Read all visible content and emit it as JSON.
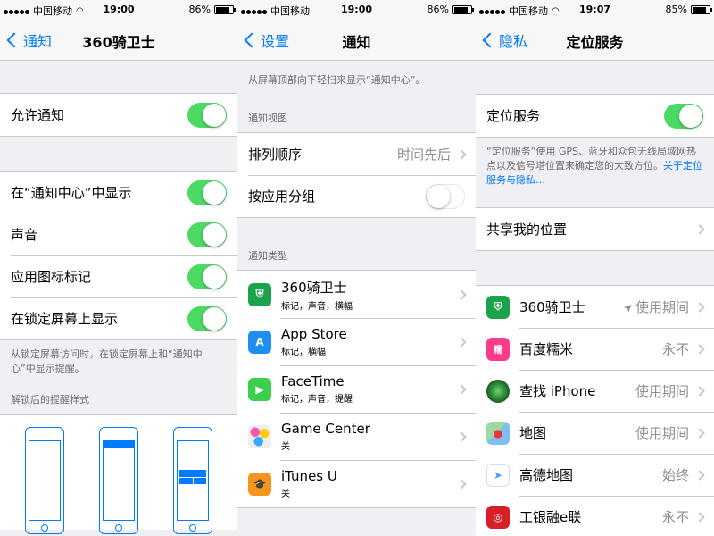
{
  "statusbars": [
    {
      "carrier": "中国移动",
      "time": "19:00",
      "battery": "86%",
      "battery_fill": 0.86
    },
    {
      "carrier": "中国移动",
      "time": "19:00",
      "battery": "86%",
      "battery_fill": 0.86
    },
    {
      "carrier": "中国移动",
      "time": "19:07",
      "battery": "85%",
      "battery_fill": 0.85
    }
  ],
  "screen1": {
    "back_label": "通知",
    "title": "360骑卫士",
    "allow_label": "允许通知",
    "rows": [
      {
        "label": "在“通知中心”中显示"
      },
      {
        "label": "声音"
      },
      {
        "label": "应用图标标记"
      },
      {
        "label": "在锁定屏幕上显示"
      }
    ],
    "footer": "从锁定屏幕访问时，在锁定屏幕上和“通知中心”中显示提醒。",
    "alert_style_header": "解锁后的提醒样式"
  },
  "screen2": {
    "back_label": "设置",
    "title": "通知",
    "intro": "从屏幕顶部向下轻扫来显示“通知中心”。",
    "view_header": "通知视图",
    "sort_label": "排列顺序",
    "sort_value": "时间先后",
    "group_label": "按应用分组",
    "type_header": "通知类型",
    "apps": [
      {
        "name": "360骑卫士",
        "sub": "标记，声音，横幅",
        "icon": "shield-icon",
        "color": "#1aa34a"
      },
      {
        "name": "App Store",
        "sub": "标记，横幅",
        "icon": "app-store-icon",
        "color": "#1e8ef0"
      },
      {
        "name": "FaceTime",
        "sub": "标记，声音，提醒",
        "icon": "video-camera-icon",
        "color": "#3ccf4e"
      },
      {
        "name": "Game Center",
        "sub": "关",
        "icon": "game-center-icon",
        "color": "#e8e8e8"
      },
      {
        "name": "iTunes U",
        "sub": "关",
        "icon": "graduation-cap-icon",
        "color": "#f7941d"
      }
    ]
  },
  "screen3": {
    "back_label": "隐私",
    "title": "定位服务",
    "location_label": "定位服务",
    "desc": "“定位服务”使用 GPS、蓝牙和众包无线局域网热点以及信号塔位置来确定您的大致方位。",
    "desc_link": "关于定位服务与隐私…",
    "share_label": "共享我的位置",
    "apps": [
      {
        "name": "360骑卫士",
        "value": "使用期间",
        "icon": "shield-icon",
        "color": "#1aa34a",
        "arrow": true
      },
      {
        "name": "百度糯米",
        "value": "永不",
        "icon": "baidu-nuomi-icon",
        "color": "#ff3b8d",
        "arrow": false
      },
      {
        "name": "查找 iPhone",
        "value": "使用期间",
        "icon": "radar-icon",
        "color": "#2a8a3a",
        "arrow": false
      },
      {
        "name": "地图",
        "value": "使用期间",
        "icon": "maps-icon",
        "color": "#7fbfef",
        "arrow": false
      },
      {
        "name": "高德地图",
        "value": "始终",
        "icon": "navigation-arrow-icon",
        "color": "#4aa3f0",
        "arrow": false
      },
      {
        "name": "工银融e联",
        "value": "永不",
        "icon": "icbc-icon",
        "color": "#d61f26",
        "arrow": false
      }
    ]
  }
}
